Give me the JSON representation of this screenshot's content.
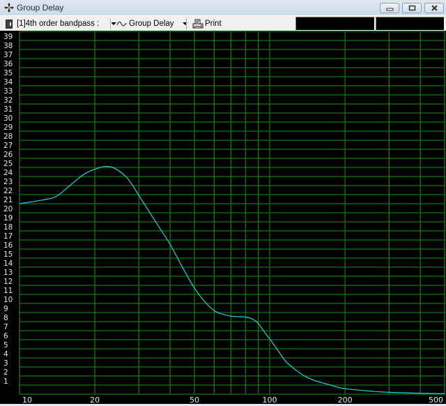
{
  "window": {
    "title": "Group Delay",
    "icon": "crosshair-move-icon",
    "buttons": [
      "minimize",
      "maximize",
      "close"
    ]
  },
  "toolbar": {
    "project_selector": {
      "icon": "document-icon",
      "label": "[1]4th order bandpass :"
    },
    "graph_selector": {
      "icon": "waveform-icon",
      "label": "Group Delay"
    },
    "print": {
      "icon": "printer-icon",
      "label": "Print"
    },
    "readouts": [
      "",
      ""
    ]
  },
  "colors": {
    "background": "#000000",
    "grid": "#0f7a0f",
    "curve": "#17d9d9",
    "tick_label": "#e6e6e6"
  },
  "chart_data": {
    "type": "line",
    "title": "Group Delay",
    "xlabel": "",
    "ylabel": "",
    "x_scale": "log",
    "xlim": [
      10,
      500
    ],
    "ylim": [
      0,
      40
    ],
    "grid": true,
    "x_ticks": [
      10,
      20,
      30,
      40,
      50,
      60,
      70,
      80,
      90,
      100,
      200,
      300,
      400,
      500
    ],
    "x_tick_labels": [
      {
        "value": 10,
        "label": "10"
      },
      {
        "value": 20,
        "label": "20"
      },
      {
        "value": 50,
        "label": "50"
      },
      {
        "value": 100,
        "label": "100"
      },
      {
        "value": 200,
        "label": "200"
      },
      {
        "value": 500,
        "label": "500"
      }
    ],
    "y_ticks": [
      1,
      2,
      3,
      4,
      5,
      6,
      7,
      8,
      9,
      10,
      11,
      12,
      13,
      14,
      15,
      16,
      17,
      18,
      19,
      20,
      21,
      22,
      23,
      24,
      25,
      26,
      27,
      28,
      29,
      30,
      31,
      32,
      33,
      34,
      35,
      36,
      37,
      38,
      39
    ],
    "series": [
      {
        "name": "Group Delay",
        "x": [
          10,
          12.3,
          14,
          15.9,
          18,
          20,
          21.9,
          24,
          27,
          30,
          35.4,
          40,
          45,
          50,
          55,
          60,
          65,
          70,
          75,
          80,
          85,
          90,
          95.5,
          100,
          108,
          116,
          128,
          140,
          155,
          170,
          185,
          200,
          250,
          300,
          400,
          500
        ],
        "y": [
          21.0,
          21.4,
          21.8,
          23.0,
          24.2,
          24.8,
          25.1,
          24.9,
          23.8,
          21.9,
          18.8,
          16.5,
          13.9,
          11.7,
          10.2,
          9.2,
          8.8,
          8.6,
          8.55,
          8.5,
          8.3,
          7.8,
          6.8,
          6.1,
          4.8,
          3.6,
          2.6,
          1.9,
          1.4,
          1.1,
          0.8,
          0.6,
          0.35,
          0.2,
          0.1,
          0.05
        ]
      }
    ]
  }
}
